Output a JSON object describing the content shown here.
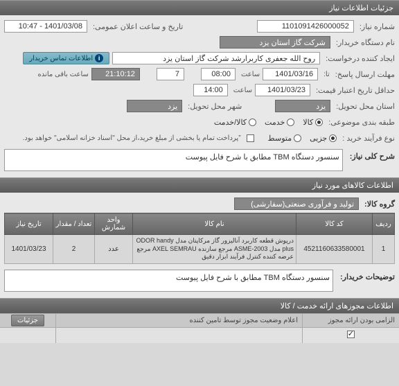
{
  "panels": {
    "main": "جزئیات اطلاعات نیاز",
    "goods": "اطلاعات کالاهای مورد نیاز",
    "approvals": "اطلاعات مجوزهای ارائه خدمت / کالا"
  },
  "labels": {
    "need_no": "شماره نیاز:",
    "public_datetime": "تاریخ و ساعت اعلان عمومی:",
    "buyer_org": "نام دستگاه خریدار:",
    "requester": "ایجاد کننده درخواست:",
    "contact_info": "اطلاعات تماس خریدار",
    "reply_deadline": "مهلت ارسال پاسخ:",
    "to": "تا:",
    "hour": "ساعت",
    "remaining": "ساعت باقی مانده",
    "min_valid_date": "حداقل تاریخ اعتبار قیمت:",
    "delivery_province": "استان محل تحویل:",
    "delivery_city": "شهر محل تحویل:",
    "item_class": "طبقه بندی موضوعی:",
    "process_type": "نوع فرآیند خرید :",
    "payment_note": "”پرداخت تمام یا بخشی از مبلغ خرید،از محل \"اسناد خزانه اسلامی\" خواهد بود.",
    "need_title": "شرح کلی نیاز:",
    "product_group": "گروه کالا:",
    "buyer_notes": "توضیحات خریدار:",
    "mandatory": "الزامی بودن ارائه مجوز",
    "supplier_status": "اعلام وضعیت مجوز توسط تامین کننده",
    "details": "جزئیات"
  },
  "values": {
    "need_no": "1101091426000052",
    "public_datetime": "1401/03/08 - 10:47",
    "buyer_org": "شرکت گاز استان یزد",
    "requester": "روح الله جعفری کاربرارشد شرکت گاز استان یزد",
    "deadline_date": "1401/03/16",
    "deadline_time": "08:00",
    "deadline_days": "7",
    "remaining_time": "21:10:12",
    "min_valid_date": "1401/03/23",
    "min_valid_time": "14:00",
    "delivery_province": "یزد",
    "delivery_city": "یزد",
    "need_title": "سنسور دستگاه TBM  مطابق  با  شرح  فایل  پیوست",
    "product_group": "تولید و فرآوری صنعتی(سفارشی)",
    "buyer_notes": "سنسور دستگاه TBM  مطابق  با  شرح  فایل  پیوست"
  },
  "radios": {
    "class_goods": "کالا",
    "class_service": "خدمت",
    "class_goods_service": "کالا/خدمت",
    "proc_partial": "جزیی",
    "proc_medium": "متوسط"
  },
  "table": {
    "headers": {
      "row": "ردیف",
      "code": "کد کالا",
      "name": "نام کالا",
      "unit": "واحد شمارش",
      "qty": "تعداد / مقدار",
      "date": "تاریخ نیاز"
    },
    "rows": [
      {
        "idx": "1",
        "code": "4521160633580001",
        "name": "درپوش قطعه کاربرد آنالیزور گاز مرکاپتان مدل ODOR handy plus مدل ASME-2003 مرجع سازنده AXEL SEMRAU مرجع عرضه کننده کنترل فرآیند ابزار دقیق",
        "unit": "عدد",
        "qty": "2",
        "date": "1401/03/23"
      }
    ]
  },
  "checkbox_checked": "✓"
}
